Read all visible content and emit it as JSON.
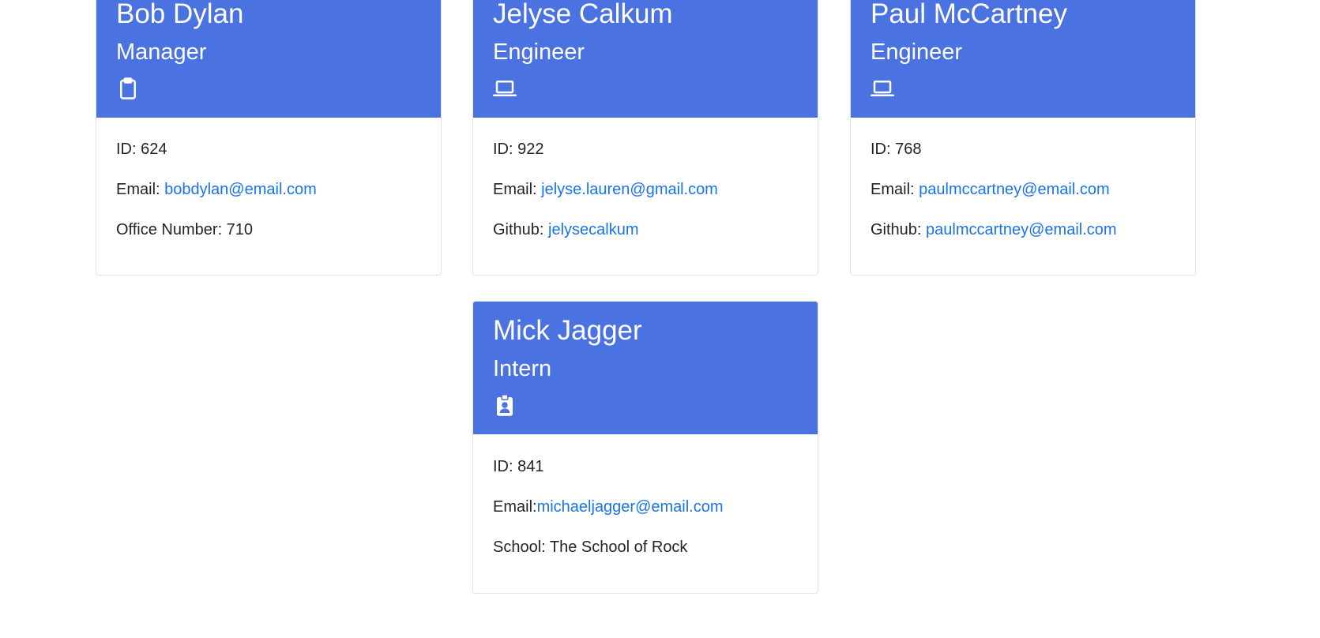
{
  "cards": [
    {
      "name": "Bob Dylan",
      "role": "Manager",
      "icon": "clipboard-icon",
      "id_text": "ID: 624",
      "email_label": "Email: ",
      "email": "bobdylan@email.com",
      "extra_label": "Office Number: 710"
    },
    {
      "name": "Jelyse Calkum",
      "role": "Engineer",
      "icon": "laptop-icon",
      "id_text": "ID: 922",
      "email_label": "Email: ",
      "email": "jelyse.lauren@gmail.com",
      "extra_label": "Github: ",
      "extra_link": "jelysecalkum"
    },
    {
      "name": "Paul McCartney",
      "role": "Engineer",
      "icon": "laptop-icon",
      "id_text": "ID: 768",
      "email_label": "Email: ",
      "email": "paulmccartney@email.com",
      "extra_label": "Github: ",
      "extra_link": "paulmccartney@email.com"
    },
    {
      "name": "Mick Jagger",
      "role": "Intern",
      "icon": "id-badge-icon",
      "id_text": "ID: 841",
      "email_label": "Email:",
      "email": "michaeljagger@email.com",
      "extra_label": "School: The School of Rock"
    }
  ],
  "colors": {
    "header_bg": "#4a72e0",
    "link": "#1a73e8"
  }
}
